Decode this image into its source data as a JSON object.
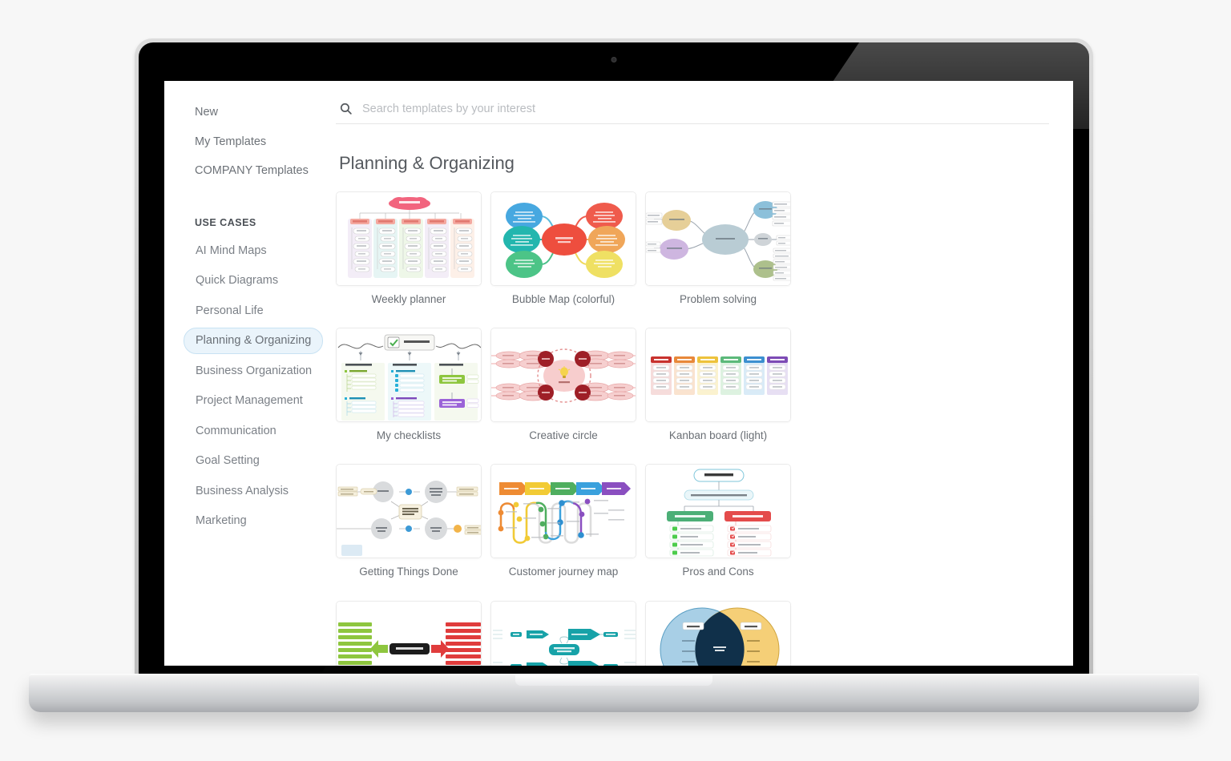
{
  "device": {
    "type": "laptop-mockup"
  },
  "search": {
    "placeholder": "Search templates by your interest",
    "value": "",
    "icon": "search-icon"
  },
  "sidebar": {
    "top_links": [
      {
        "label": "New"
      },
      {
        "label": "My Templates"
      },
      {
        "label": "COMPANY Templates"
      }
    ],
    "section_label": "USE CASES",
    "items": [
      {
        "label": "AI Mind Maps",
        "selected": false
      },
      {
        "label": "Quick Diagrams",
        "selected": false
      },
      {
        "label": "Personal Life",
        "selected": false
      },
      {
        "label": "Planning & Organizing",
        "selected": true
      },
      {
        "label": "Business Organization",
        "selected": false
      },
      {
        "label": "Project Management",
        "selected": false
      },
      {
        "label": "Communication",
        "selected": false
      },
      {
        "label": "Goal Setting",
        "selected": false
      },
      {
        "label": "Business Analysis",
        "selected": false
      },
      {
        "label": "Marketing",
        "selected": false
      }
    ]
  },
  "main": {
    "title": "Planning & Organizing",
    "templates": [
      {
        "label": "Weekly planner",
        "thumb": "weekly-planner"
      },
      {
        "label": "Bubble Map (colorful)",
        "thumb": "bubble-map"
      },
      {
        "label": "Problem solving",
        "thumb": "problem-solving"
      },
      {
        "label": "My checklists",
        "thumb": "my-checklists"
      },
      {
        "label": "Creative circle",
        "thumb": "creative-circle"
      },
      {
        "label": "Kanban board (light)",
        "thumb": "kanban-board"
      },
      {
        "label": "Getting Things Done",
        "thumb": "getting-things-done"
      },
      {
        "label": "Customer journey map",
        "thumb": "customer-journey"
      },
      {
        "label": "Pros and Cons",
        "thumb": "pros-and-cons"
      },
      {
        "label": "",
        "thumb": "force-field"
      },
      {
        "label": "",
        "thumb": "teal-arrows"
      },
      {
        "label": "",
        "thumb": "venn-diagram"
      }
    ]
  },
  "colors": {
    "selected_pill_bg": "#eaf4fb",
    "selected_pill_border": "#c8e2f3",
    "text_muted": "#7b8087",
    "page_bg": "#f7f7f7",
    "kanban": [
      "#c8322e",
      "#e8883a",
      "#edc23c",
      "#5cb97a",
      "#3c8fd0",
      "#7d4bb5"
    ],
    "journey": [
      "#ee8b33",
      "#f2cb35",
      "#4fae5f",
      "#3aa1dd",
      "#8a4fc0"
    ],
    "venn": [
      "#a8cfe6",
      "#f5cf77",
      "#10304a"
    ]
  }
}
